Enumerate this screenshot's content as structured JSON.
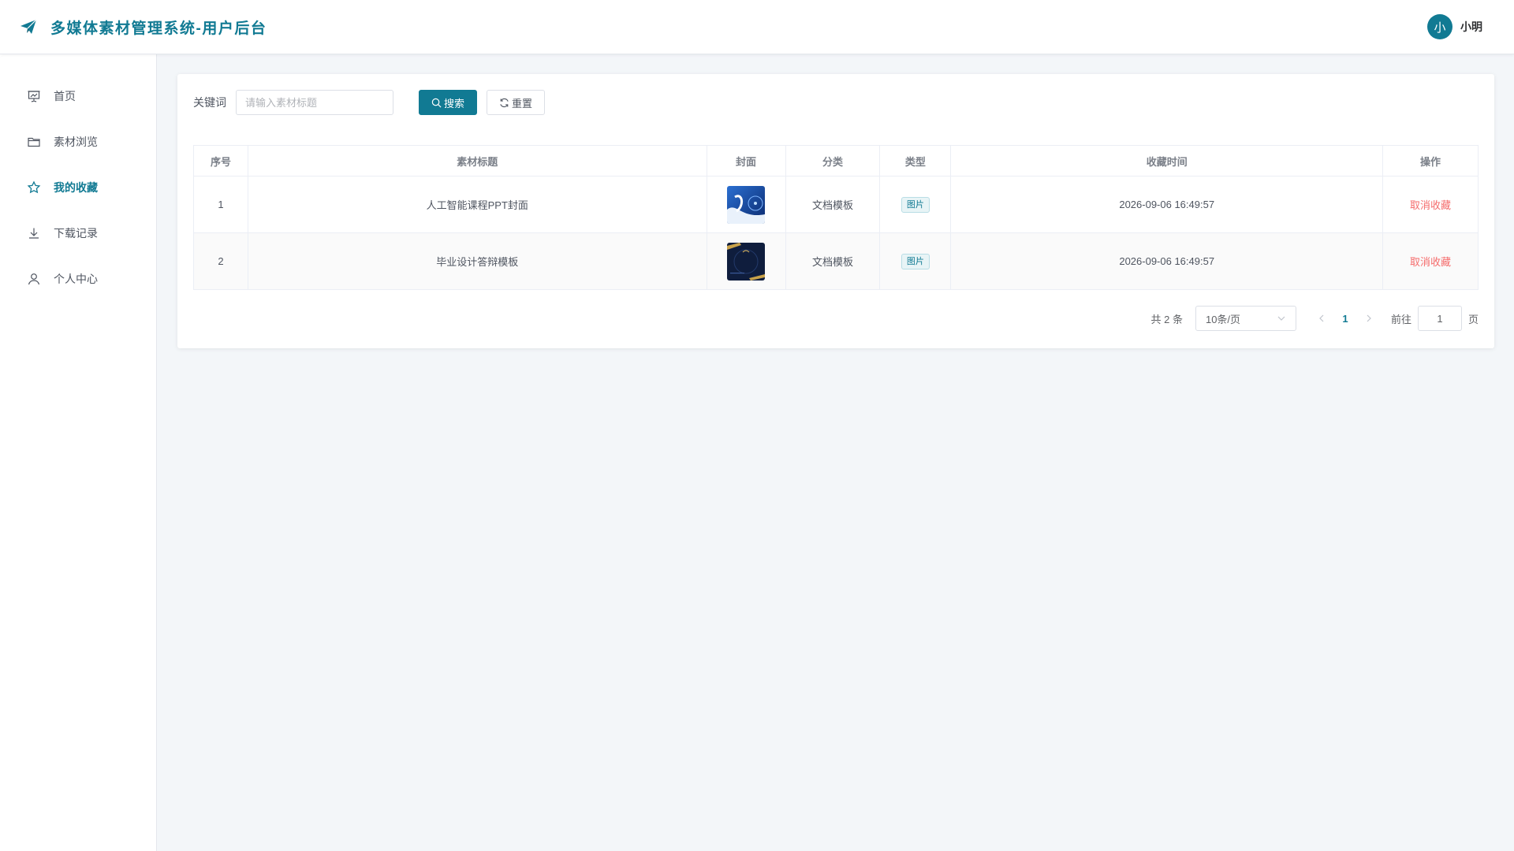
{
  "header": {
    "title": "多媒体素材管理系统-用户后台",
    "brand_icon": "paper-plane-icon",
    "accent_color": "#117a93",
    "user": {
      "avatar_text": "小",
      "name": "小明"
    }
  },
  "sidebar": {
    "items": [
      {
        "label": "首页",
        "icon": "presentation-icon",
        "active": false
      },
      {
        "label": "素材浏览",
        "icon": "folder-icon",
        "active": false
      },
      {
        "label": "我的收藏",
        "icon": "star-icon",
        "active": true
      },
      {
        "label": "下载记录",
        "icon": "download-icon",
        "active": false
      },
      {
        "label": "个人中心",
        "icon": "user-icon",
        "active": false
      }
    ]
  },
  "search": {
    "label": "关键词",
    "placeholder": "请输入素材标题",
    "value": "",
    "search_button": "搜索",
    "reset_button": "重置"
  },
  "table": {
    "columns": [
      "序号",
      "素材标题",
      "封面",
      "分类",
      "类型",
      "收藏时间",
      "操作"
    ],
    "rows": [
      {
        "index": "1",
        "title": "人工智能课程PPT封面",
        "category": "文档模板",
        "type": "图片",
        "time": "2026-09-06 16:49:57",
        "action": "取消收藏"
      },
      {
        "index": "2",
        "title": "毕业设计答辩模板",
        "category": "文档模板",
        "type": "图片",
        "time": "2026-09-06 16:49:57",
        "action": "取消收藏"
      }
    ]
  },
  "pagination": {
    "total": "共 2 条",
    "page_size": "10条/页",
    "current_page": "1",
    "jump_label": "前往",
    "jump_value": "1",
    "jump_suffix": "页"
  }
}
